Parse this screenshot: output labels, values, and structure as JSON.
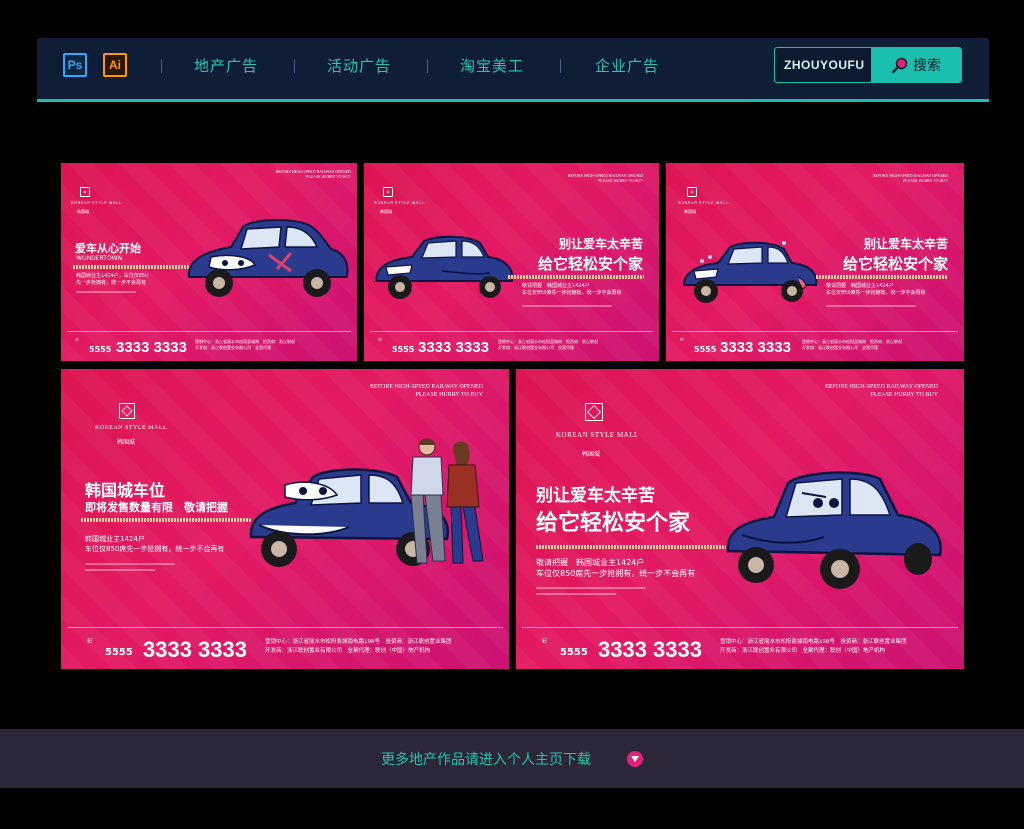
{
  "nav": {
    "ps_label": "Ps",
    "ai_label": "Ai",
    "items": [
      "地产广告",
      "活动广告",
      "淘宝美工",
      "企业广告"
    ],
    "search_value": "ZHOUYOUFU",
    "search_button": "搜索"
  },
  "common": {
    "top_line1": "BEFORE HIGH-SPEED RAILWAY OPENED",
    "top_line2": "PLEASE HURRY TO BUY",
    "logo_en": "KOREAN STYLE MALL",
    "logo_cn": "韩国城",
    "ext": "5555",
    "phone": "3333 3333",
    "info_line1": "营销中心：浙江省丽水市松阳县城南电路198号　投资商：浙江联创置业集团",
    "info_line2": "开发商：浙江联创置业有限公司　全案代理：联创（中国）地产机构",
    "info_line1_short": "营销中心：浙江省丽水市松阳县城南　投资商：浙江联创",
    "info_line2_short": "开发商：浙江联创置业有限公司　全案代理"
  },
  "cards": {
    "c1": {
      "headline": "爱车从心开始",
      "sub_en": "WONDERTOWN",
      "body1": "韩国城业主1424户，车位仅850",
      "body2": "先一步抢拥有，统一步不会再有"
    },
    "c2": {
      "headline1": "别让爱车太辛苦",
      "headline2": "给它轻松安个家",
      "body1": "敬请把握　韩国城业主1424户",
      "body2": "车位仅850席先一步抢拥有，统一步不会再有"
    },
    "c3": {
      "headline1": "别让爱车太辛苦",
      "headline2": "给它轻松安个家",
      "body1": "敬请把握　韩国城业主1424户",
      "body2": "车位仅850席先一步抢拥有，统一步不会再有"
    },
    "c4": {
      "headline1": "韩国城车位",
      "headline2": "即将发售数量有限　敬请把握",
      "body1": "韩国城业主1424户",
      "body2": "车位仅850席先一步抢拥有，统一步不会再有"
    },
    "c5": {
      "headline1": "别让爱车太辛苦",
      "headline2": "给它轻松安个家",
      "body1": "敬请把握　韩国城业主1424户",
      "body2": "车位仅850席先一步抢拥有，统一步不会再有"
    }
  },
  "footer": {
    "link": "更多地产作品请进入个人主页下载"
  },
  "colors": {
    "accent": "#1bbfae",
    "nav_bg": "#101d36",
    "card_pink": "#e31a63",
    "car_blue": "#1f2a6e"
  }
}
